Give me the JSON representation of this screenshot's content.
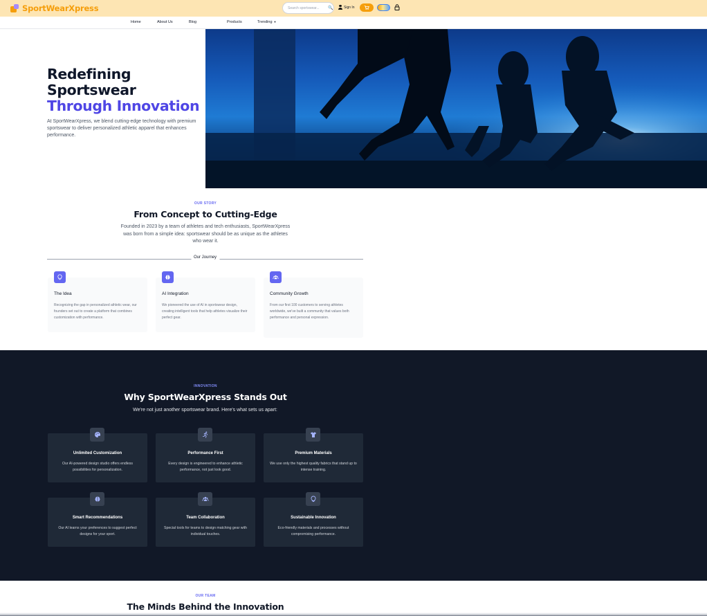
{
  "brand": {
    "name": "SportWearXpress",
    "primary_color": "#f59e0b",
    "accent_color": "#4f46e5"
  },
  "header": {
    "search_placeholder": "Search sportswear...",
    "signin_label": "Sign In",
    "icons": [
      "search-icon",
      "user-icon",
      "cart-icon",
      "theme-toggle",
      "lock-icon"
    ]
  },
  "nav": {
    "items": [
      "Home",
      "About Us",
      "Blog",
      "Products",
      "Trending"
    ]
  },
  "hero": {
    "title_line1": "Redefining",
    "title_line2": "Sportswear",
    "title_accent": "Through Innovation",
    "subtitle": "At SportWearXpress, we blend cutting-edge technology with premium sportswear to deliver personalized athletic apparel that enhances performance."
  },
  "story": {
    "eyebrow": "OUR STORY",
    "title": "From Concept to Cutting-Edge",
    "description": "Founded in 2023 by a team of athletes and tech enthusiasts, SportWearXpress was born from a simple idea: sportswear should be as unique as the athletes who wear it.",
    "journey_label": "Our Journey",
    "cards": [
      {
        "icon": "lightbulb-icon",
        "title": "The Idea",
        "text": "Recognizing the gap in personalized athletic wear, our founders set out to create a platform that combines customization with performance."
      },
      {
        "icon": "brain-icon",
        "title": "AI Integration",
        "text": "We pioneered the use of AI in sportswear design, creating intelligent tools that help athletes visualize their perfect gear."
      },
      {
        "icon": "users-icon",
        "title": "Community Growth",
        "text": "From our first 100 customers to serving athletes worldwide, we've built a community that values both performance and personal expression."
      }
    ]
  },
  "innovation": {
    "eyebrow": "INNOVATION",
    "title": "Why SportWearXpress Stands Out",
    "description": "We're not just another sportswear brand. Here's what sets us apart:",
    "features": [
      {
        "icon": "palette-icon",
        "title": "Unlimited Customization",
        "text": "Our AI-powered design studio offers endless possibilities for personalization."
      },
      {
        "icon": "runner-icon",
        "title": "Performance First",
        "text": "Every design is engineered to enhance athletic performance, not just look good."
      },
      {
        "icon": "shirt-icon",
        "title": "Premium Materials",
        "text": "We use only the highest quality fabrics that stand up to intense training."
      },
      {
        "icon": "brain-icon",
        "title": "Smart Recommendations",
        "text": "Our AI learns your preferences to suggest perfect designs for your sport."
      },
      {
        "icon": "users-icon",
        "title": "Team Collaboration",
        "text": "Special tools for teams to design matching gear with individual touches."
      },
      {
        "icon": "lightbulb-icon",
        "title": "Sustainable Innovation",
        "text": "Eco-friendly materials and processes without compromising performance."
      }
    ]
  },
  "team": {
    "eyebrow": "OUR TEAM",
    "title": "The Minds Behind the Innovation"
  }
}
